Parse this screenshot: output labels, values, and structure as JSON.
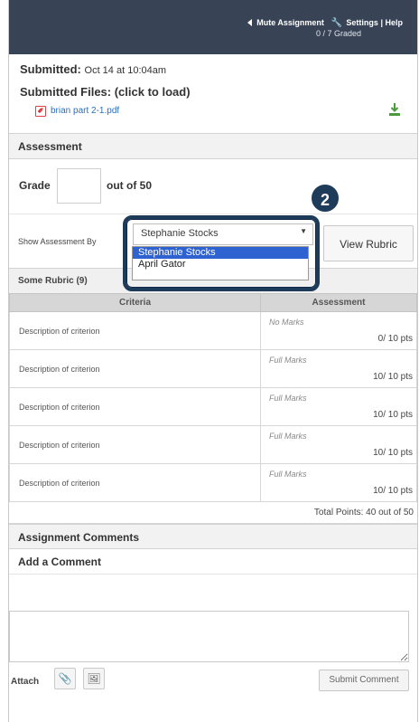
{
  "topbar": {
    "mute": "Mute Assignment",
    "settings": "Settings",
    "separator": "|",
    "help": "Help",
    "graded": "0 / 7 Graded"
  },
  "submission": {
    "submitted_label": "Submitted:",
    "submitted_value": "Oct 14 at 10:04am",
    "files_label": "Submitted Files: (click to load)",
    "file_name": "brian part 2-1.pdf"
  },
  "assessment": {
    "title": "Assessment",
    "grade_label": "Grade",
    "grade_value": "",
    "out_of": "out of 50",
    "show_by_label": "Show Assessment By",
    "selected_assessor": "Stephanie Stocks",
    "view_rubric": "View Rubric",
    "dropdown_options": [
      "Stephanie Stocks",
      "April Gator"
    ],
    "callout_number": "2"
  },
  "rubric": {
    "title": "Some Rubric (9)",
    "headers": [
      "Criteria",
      "Assessment"
    ],
    "rows": [
      {
        "criterion": "Description of criterion",
        "marks": "No Marks",
        "points": "0/ 10 pts"
      },
      {
        "criterion": "Description of criterion",
        "marks": "Full Marks",
        "points": "10/ 10 pts"
      },
      {
        "criterion": "Description of criterion",
        "marks": "Full Marks",
        "points": "10/ 10 pts"
      },
      {
        "criterion": "Description of criterion",
        "marks": "Full Marks",
        "points": "10/ 10 pts"
      },
      {
        "criterion": "Description of criterion",
        "marks": "Full Marks",
        "points": "10/ 10 pts"
      }
    ],
    "total": "Total Points: 40 out of 50"
  },
  "comments": {
    "title": "Assignment Comments",
    "add_title": "Add a Comment",
    "comment_value": "",
    "attach_label": "Attach",
    "submit_label": "Submit Comment"
  },
  "colors": {
    "topbar": "#384456",
    "highlight": "#1f3b5a",
    "selected_item": "#2e62d0"
  }
}
